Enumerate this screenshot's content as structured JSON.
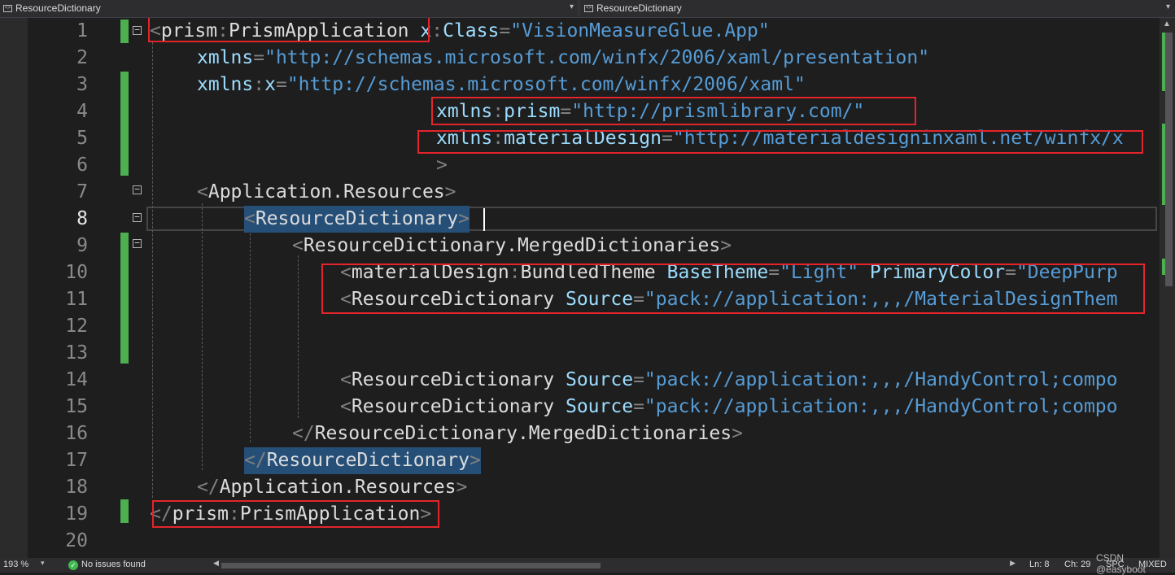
{
  "nav": {
    "left_label": "ResourceDictionary",
    "right_label": "ResourceDictionary"
  },
  "editor": {
    "line_numbers": [
      "1",
      "2",
      "3",
      "4",
      "5",
      "6",
      "7",
      "8",
      "9",
      "10",
      "11",
      "12",
      "13",
      "14",
      "15",
      "16",
      "17",
      "18",
      "19",
      "20"
    ],
    "current_line": 8,
    "code": {
      "l1": [
        "<",
        "prism",
        ":",
        "PrismApplication",
        " ",
        "x",
        ":",
        "Class",
        "=",
        "\"VisionMeasureGlue.App\""
      ],
      "l2": [
        "xmlns",
        "=",
        "\"http://schemas.microsoft.com/winfx/2006/xaml/presentation\""
      ],
      "l3": [
        "xmlns",
        ":",
        "x",
        "=",
        "\"http://schemas.microsoft.com/winfx/2006/xaml\""
      ],
      "l4": [
        "xmlns",
        ":",
        "prism",
        "=",
        "\"http://prismlibrary.com/\""
      ],
      "l5": [
        "xmlns",
        ":",
        "materialDesign",
        "=",
        "\"http://materialdesigninxaml.net/winfx/x"
      ],
      "l6": [
        ">"
      ],
      "l7": [
        "<",
        "Application.Resources",
        ">"
      ],
      "l8": [
        "<",
        "ResourceDictionary",
        ">"
      ],
      "l9": [
        "<",
        "ResourceDictionary.MergedDictionaries",
        ">"
      ],
      "l10": [
        "<",
        "materialDesign",
        ":",
        "BundledTheme",
        " ",
        "BaseTheme",
        "=",
        "\"Light\"",
        " ",
        "PrimaryColor",
        "=",
        "\"DeepPurp"
      ],
      "l11": [
        "<",
        "ResourceDictionary",
        " ",
        "Source",
        "=",
        "\"pack://application:,,,/MaterialDesignThem"
      ],
      "l14": [
        "<",
        "ResourceDictionary",
        " ",
        "Source",
        "=",
        "\"pack://application:,,,/HandyControl;compo"
      ],
      "l15": [
        "<",
        "ResourceDictionary",
        " ",
        "Source",
        "=",
        "\"pack://application:,,,/HandyControl;compo"
      ],
      "l16": [
        "</",
        "ResourceDictionary.MergedDictionaries",
        ">"
      ],
      "l17": [
        "</",
        "ResourceDictionary",
        ">"
      ],
      "l18": [
        "</",
        "Application.Resources",
        ">"
      ],
      "l19": [
        "</",
        "prism",
        ":",
        "PrismApplication",
        ">"
      ]
    },
    "fold_glyph": "−"
  },
  "status": {
    "zoom": "193 %",
    "issues": "No issues found",
    "line": "Ln: 8",
    "col": "Ch: 29",
    "whitespace": "SPC",
    "line_endings": "MIXED"
  },
  "watermark": "CSDN @easyboot",
  "colors": {
    "background": "#1e1e1e",
    "tag": "#dcdcdc",
    "attribute": "#9cdcfe",
    "string": "#569cd6",
    "punctuation": "#808080",
    "selection": "#264f78",
    "change_marker": "#4caf50",
    "annotation_box": "#e3252b"
  }
}
